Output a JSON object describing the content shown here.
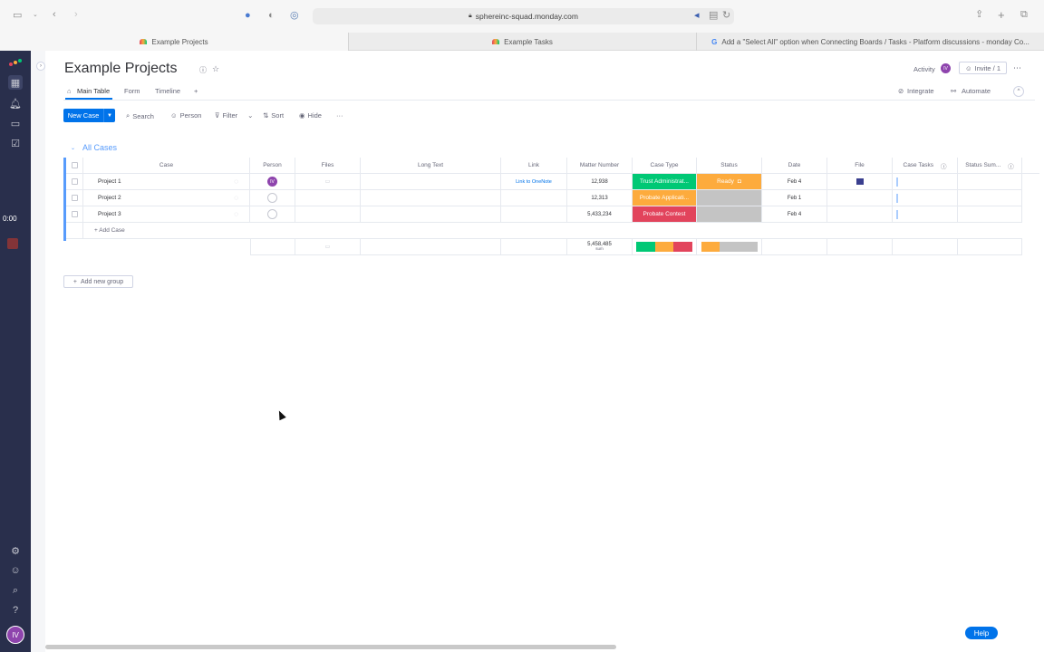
{
  "browser": {
    "url": "sphereinc-squad.monday.com",
    "tabs": [
      {
        "label": "Example Projects",
        "active": true
      },
      {
        "label": "Example Tasks",
        "active": false
      },
      {
        "label": "Add a \"Select All\" option when Connecting Boards / Tasks - Platform discussions - monday Co...",
        "active": false
      }
    ]
  },
  "rail": {
    "timer": "0:00",
    "user_initials": "IV"
  },
  "board": {
    "title": "Example Projects",
    "activity_label": "Activity",
    "activity_initials": "IV",
    "invite_label": "Invite / 1",
    "views": [
      "Main Table",
      "Form",
      "Timeline",
      "+"
    ],
    "integrate_label": "Integrate",
    "automate_label": "Automate",
    "toolbar": {
      "new_button": "New Case",
      "search": "Search",
      "person": "Person",
      "filter": "Filter",
      "sort": "Sort",
      "hide": "Hide",
      "more": "···"
    },
    "group": {
      "title": "All Cases",
      "add_item": "+ Add Case",
      "add_group": "Add new group"
    },
    "columns": [
      "Case",
      "Person",
      "Files",
      "Long Text",
      "Link",
      "Matter Number",
      "Case Type",
      "Status",
      "Date",
      "File",
      "Case Tasks",
      "Status Sum..."
    ],
    "rows": [
      {
        "name": "Project 1",
        "person": "IV",
        "link": "Link to OneNote",
        "matter": "12,938",
        "case_type": "Trust Administrat...",
        "case_type_color": "#00c875",
        "status": "Ready",
        "status_color": "#fdab3d",
        "date": "Feb 4"
      },
      {
        "name": "Project 2",
        "person": "",
        "link": "",
        "matter": "12,313",
        "case_type": "Probate Applicati...",
        "case_type_color": "#fdab3d",
        "status": "",
        "status_color": "#c4c4c4",
        "date": "Feb 1"
      },
      {
        "name": "Project 3",
        "person": "",
        "link": "",
        "matter": "5,433,234",
        "case_type": "Probate Contest",
        "case_type_color": "#e2445c",
        "status": "",
        "status_color": "#c4c4c4",
        "date": "Feb 4"
      }
    ],
    "summary": {
      "matter_sum": "5,458,485",
      "matter_sum_label": "sum"
    },
    "help_label": "Help"
  },
  "colors": {
    "accent": "#0073ea",
    "group": "#579bfc",
    "rail": "#292f4c"
  }
}
